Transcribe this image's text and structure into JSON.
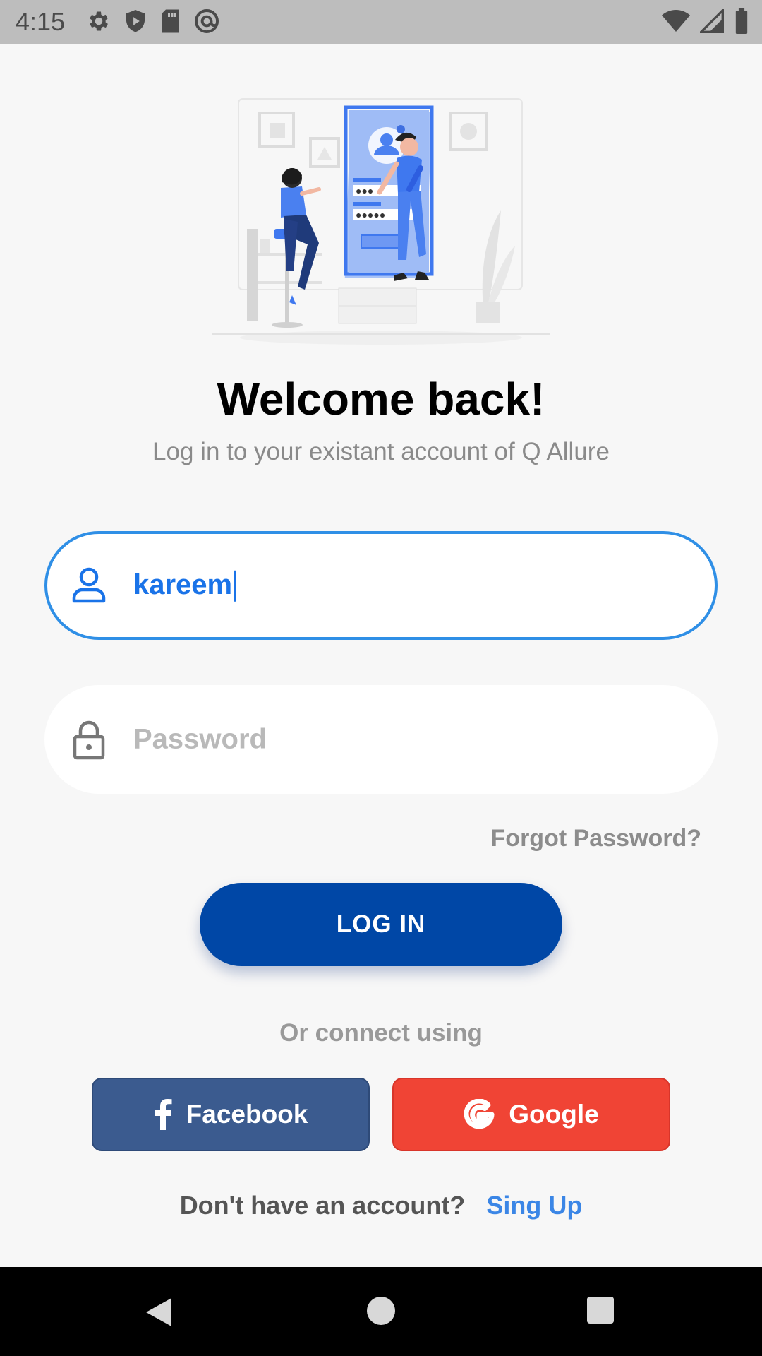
{
  "status_bar": {
    "time": "4:15",
    "left_icons": [
      "settings-icon",
      "shield-icon",
      "sd-card-icon",
      "at-sign-icon"
    ],
    "right_icons": [
      "wifi-icon",
      "cell-signal-icon",
      "battery-icon"
    ]
  },
  "header": {
    "title": "Welcome back!",
    "subtitle": "Log in to your existant account of Q Allure"
  },
  "form": {
    "username_value": "kareem",
    "password_placeholder": "Password",
    "forgot_label": "Forgot Password?",
    "login_label": "LOG IN"
  },
  "social": {
    "connect_label": "Or connect using",
    "facebook_label": "Facebook",
    "google_label": "Google"
  },
  "signup": {
    "prompt": "Don't have an account?",
    "link": "Sing Up"
  },
  "colors": {
    "primary": "#0047a6",
    "accent": "#2f8fe6",
    "facebook": "#3b5b8f",
    "google": "#f04435"
  },
  "nav_bar": {
    "icons": [
      "back-icon",
      "home-icon",
      "recent-apps-icon"
    ]
  }
}
